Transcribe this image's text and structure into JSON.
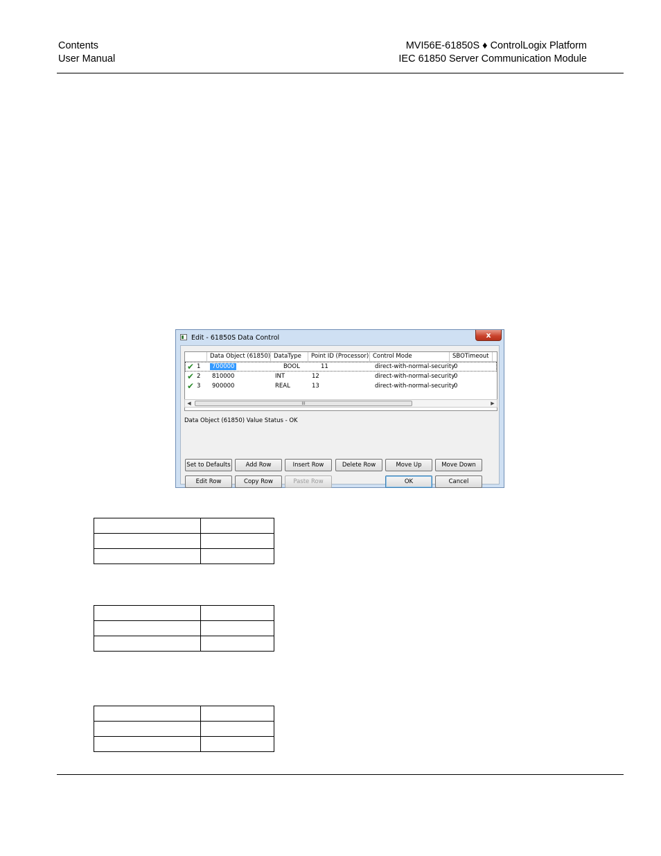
{
  "header": {
    "left_line1": "Contents",
    "left_line2": "User Manual",
    "right_line1": "MVI56E-61850S ♦ ControlLogix Platform",
    "right_line2": "IEC 61850 Server Communication Module"
  },
  "dialog": {
    "title": "Edit - 61850S Data Control",
    "close_label": "x",
    "columns": [
      "Data Object (61850)",
      "DataType",
      "Point ID (Processor)",
      "Control Mode",
      "SBOTimeout"
    ],
    "rows": [
      {
        "num": "1",
        "data_object": "700000",
        "data_type": "BOOL",
        "point_id": "11",
        "control_mode": "direct-with-normal-security",
        "sbo_timeout": "0"
      },
      {
        "num": "2",
        "data_object": "810000",
        "data_type": "INT",
        "point_id": "12",
        "control_mode": "direct-with-normal-security",
        "sbo_timeout": "0"
      },
      {
        "num": "3",
        "data_object": "900000",
        "data_type": "REAL",
        "point_id": "13",
        "control_mode": "direct-with-normal-security",
        "sbo_timeout": "0"
      }
    ],
    "scroll_thumb_label": "III",
    "status": "Data Object (61850) Value Status - OK",
    "buttons": {
      "set_defaults": "Set to Defaults",
      "add_row": "Add Row",
      "insert_row": "Insert Row",
      "delete_row": "Delete Row",
      "move_up": "Move Up",
      "move_down": "Move Down",
      "edit_row": "Edit Row",
      "copy_row": "Copy Row",
      "paste_row": "Paste Row",
      "ok": "OK",
      "cancel": "Cancel"
    }
  },
  "tables": [
    {
      "rows": [
        [
          "",
          ""
        ],
        [
          "",
          ""
        ],
        [
          "",
          ""
        ]
      ]
    },
    {
      "rows": [
        [
          "",
          ""
        ],
        [
          "",
          ""
        ],
        [
          "",
          ""
        ]
      ]
    },
    {
      "rows": [
        [
          "",
          ""
        ],
        [
          "",
          ""
        ],
        [
          "",
          ""
        ]
      ]
    }
  ]
}
